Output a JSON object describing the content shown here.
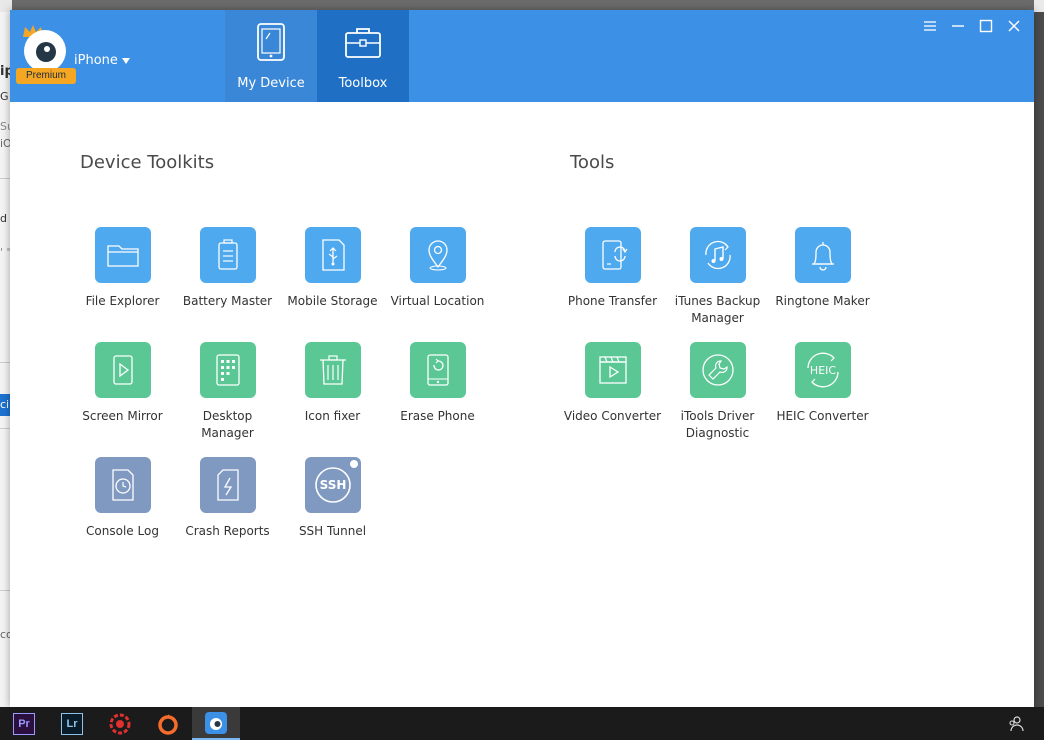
{
  "header": {
    "logo_badge": "Premium",
    "device_name": "iPhone",
    "tabs": [
      {
        "label": "My Device"
      },
      {
        "label": "Toolbox"
      }
    ]
  },
  "background_fragments": [
    "ip",
    "G",
    "Su",
    "iO",
    "d",
    "' \"",
    "ci",
    "co"
  ],
  "content": {
    "device_toolkits": {
      "title": "Device Toolkits",
      "items": [
        {
          "label": "File Explorer",
          "icon": "folder-icon",
          "color": "#4ea9ee"
        },
        {
          "label": "Battery Master",
          "icon": "battery-icon",
          "color": "#4ea9ee"
        },
        {
          "label": "Mobile Storage",
          "icon": "usb-storage-icon",
          "color": "#4ea9ee"
        },
        {
          "label": "Virtual Location",
          "icon": "location-pin-icon",
          "color": "#4ea9ee"
        },
        {
          "label": "Screen Mirror",
          "icon": "play-screen-icon",
          "color": "#5ac795"
        },
        {
          "label": "Desktop Manager",
          "icon": "app-grid-icon",
          "color": "#5ac795"
        },
        {
          "label": "Icon fixer",
          "icon": "trash-icon",
          "color": "#5ac795"
        },
        {
          "label": "Erase Phone",
          "icon": "erase-phone-icon",
          "color": "#5ac795"
        },
        {
          "label": "Console Log",
          "icon": "clock-file-icon",
          "color": "#7f99c0"
        },
        {
          "label": "Crash Reports",
          "icon": "lightning-file-icon",
          "color": "#7f99c0"
        },
        {
          "label": "SSH Tunnel",
          "icon": "ssh-icon",
          "icon_text": "SSH",
          "color": "#7f99c0"
        }
      ]
    },
    "tools": {
      "title": "Tools",
      "items": [
        {
          "label": "Phone Transfer",
          "icon": "phone-transfer-icon",
          "color": "#4ea9ee"
        },
        {
          "label": "iTunes Backup Manager",
          "icon": "music-note-icon",
          "color": "#4ea9ee"
        },
        {
          "label": "Ringtone Maker",
          "icon": "bell-icon",
          "color": "#4ea9ee"
        },
        {
          "label": "Video Converter",
          "icon": "video-clapper-icon",
          "color": "#5ac795"
        },
        {
          "label": "iTools Driver Diagnostic",
          "icon": "wrench-icon",
          "color": "#5ac795"
        },
        {
          "label": "HEIC Converter",
          "icon": "heic-icon",
          "icon_text": "HEIC",
          "color": "#5ac795"
        }
      ]
    }
  },
  "taskbar": {
    "items": [
      {
        "text": "Pr",
        "icon": "premiere-icon",
        "color": "#9999ff"
      },
      {
        "text": "Lr",
        "icon": "lightroom-icon",
        "color": "#8fc4e8"
      },
      {
        "icon": "red-gear-app-icon",
        "color": "#e0302f"
      },
      {
        "icon": "origin-icon",
        "color": "#f56c2d"
      },
      {
        "icon": "itools-icon",
        "color": "#3c91e6"
      }
    ],
    "tray_icon": "people-icon"
  }
}
